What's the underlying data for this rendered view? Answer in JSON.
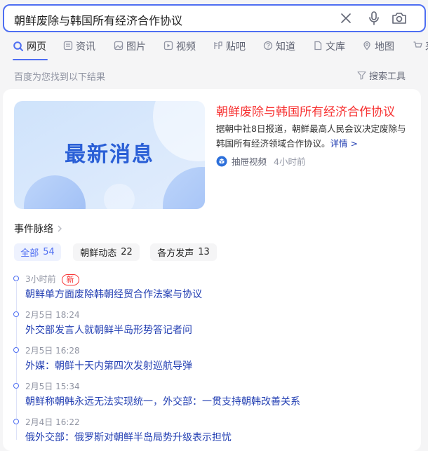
{
  "search": {
    "query": "朝鲜废除与韩国所有经济合作协议"
  },
  "tabs": [
    {
      "label": "网页",
      "icon": "search-icon",
      "active": true
    },
    {
      "label": "资讯",
      "icon": "news-icon"
    },
    {
      "label": "图片",
      "icon": "image-icon"
    },
    {
      "label": "视频",
      "icon": "video-icon"
    },
    {
      "label": "贴吧",
      "icon": "tieba-icon"
    },
    {
      "label": "知道",
      "icon": "question-icon"
    },
    {
      "label": "文库",
      "icon": "document-icon"
    },
    {
      "label": "地图",
      "icon": "map-icon"
    },
    {
      "label": "采",
      "icon": "cart-icon"
    }
  ],
  "result_info": {
    "count_text": "百度为您找到以下结果",
    "tools_label": "搜索工具"
  },
  "news": {
    "thumbnail_text": "最新消息",
    "title": "朝鲜废除与韩国所有经济合作协议",
    "description": "据朝中社8日报道，朝鲜最高人民会议决定废除与韩国所有经济领域合作协议。",
    "more_link": "详情 >",
    "source": "抽屉视频",
    "time": "4小时前"
  },
  "event": {
    "heading": "事件脉络",
    "filters": [
      {
        "label": "全部",
        "count": "54",
        "active": true
      },
      {
        "label": "朝鲜动态",
        "count": "22"
      },
      {
        "label": "各方发声",
        "count": "13"
      }
    ],
    "timeline": [
      {
        "time": "3小时前",
        "badge": "新",
        "title": "朝鲜单方面废除韩朝经贸合作法案与协议"
      },
      {
        "time": "2月5日 18:24",
        "title": "外交部发言人就朝鲜半岛形势答记者问"
      },
      {
        "time": "2月5日 16:28",
        "title": "外媒：朝鲜十天内第四次发射巡航导弹"
      },
      {
        "time": "2月5日 15:34",
        "title": "朝鲜称朝韩永远无法实现统一，外交部：一贯支持朝韩改善关系"
      },
      {
        "time": "2月4日 16:22",
        "title": "俄外交部：俄罗斯对朝鲜半岛局势升级表示担忧"
      }
    ]
  },
  "colors": {
    "accent": "#4e6ef2",
    "title_red": "#f73131",
    "link_blue": "#2440b3"
  }
}
